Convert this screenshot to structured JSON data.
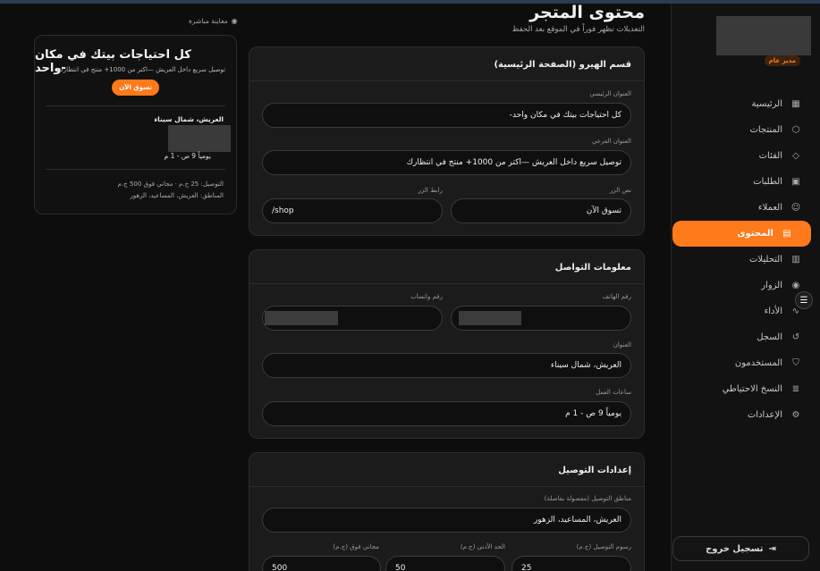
{
  "sidebar": {
    "role_badge": "مدير عام",
    "items": [
      {
        "label": "الرئيسية",
        "icon": "grid-icon",
        "glyph": "▦"
      },
      {
        "label": "المنتجات",
        "icon": "box-icon",
        "glyph": "⬡"
      },
      {
        "label": "الفئات",
        "icon": "tag-icon",
        "glyph": "◇"
      },
      {
        "label": "الطلبات",
        "icon": "bag-icon",
        "glyph": "▣"
      },
      {
        "label": "العملاء",
        "icon": "users-icon",
        "glyph": "☺"
      },
      {
        "label": "المحتوى",
        "icon": "document-icon",
        "glyph": "▤"
      },
      {
        "label": "التحليلات",
        "icon": "bar-chart-icon",
        "glyph": "▥"
      },
      {
        "label": "الزوار",
        "icon": "eye-icon",
        "glyph": "◉"
      },
      {
        "label": "الأداء",
        "icon": "pulse-icon",
        "glyph": "∿"
      },
      {
        "label": "السجل",
        "icon": "history-icon",
        "glyph": "↺"
      },
      {
        "label": "المستخدمون",
        "icon": "shield-icon",
        "glyph": "⛉"
      },
      {
        "label": "النسخ الاحتياطي",
        "icon": "database-icon",
        "glyph": "≣"
      },
      {
        "label": "الإعدادات",
        "icon": "gear-icon",
        "glyph": "⚙"
      }
    ],
    "logout_label": "تسجيل خروج"
  },
  "header": {
    "title": "محتوى المتجر",
    "subtitle": "التعديلات تظهر فوراً في الموقع بعد الحفظ"
  },
  "hero": {
    "heading": "قسم الهيرو (الصفحة الرئيسية)",
    "title_label": "العنوان الرئيسي",
    "title_value": "كل احتياجات بيتك في مكان واحد-",
    "subtitle_label": "العنوان الفرعي",
    "subtitle_value": "توصيل سريع داخل العريش —اكتر من 1000+ منتج في انتظارك",
    "button_text_label": "نص الزر",
    "button_text_value": "تسوق الآن",
    "button_link_label": "رابط الزر",
    "button_link_value": "/shop"
  },
  "contact": {
    "heading": "معلومات التواصل",
    "phone_label": "رقم الهاتف",
    "whatsapp_label": "رقم واتساب",
    "address_label": "العنوان",
    "address_value": "العريش، شمال سيناء",
    "hours_label": "ساعات العمل",
    "hours_value": "يومياً 9 ص - 1 م"
  },
  "delivery": {
    "heading": "إعدادات التوصيل",
    "zones_label": "مناطق التوصيل (مفصولة بفاصلة)",
    "zones_value": "العريش، المساعيد، الزهور",
    "fee_label": "رسوم التوصيل (ج.م)",
    "fee_value": "25",
    "min_label": "الحد الأدنى (ج.م)",
    "min_value": "50",
    "free_label": "مجاني فوق (ج.م)",
    "free_value": "500"
  },
  "preview": {
    "label": "معاينة مباشرة",
    "title": "كل احتياجات بيتك في مكان واحد-",
    "subtitle": "توصيل سريع داخل العريش —اكتر من 1000+ منتج في انتظارك",
    "button": "تسوق الآن",
    "address": "العريش، شمال سيناء",
    "hours": "يومياً 9 ص - 1 م",
    "delivery_line": "التوصيل: 25 ج.م · مجاني فوق 500 ج.م",
    "zones_line": "المناطق: العريش، المساعيد، الزهور"
  }
}
